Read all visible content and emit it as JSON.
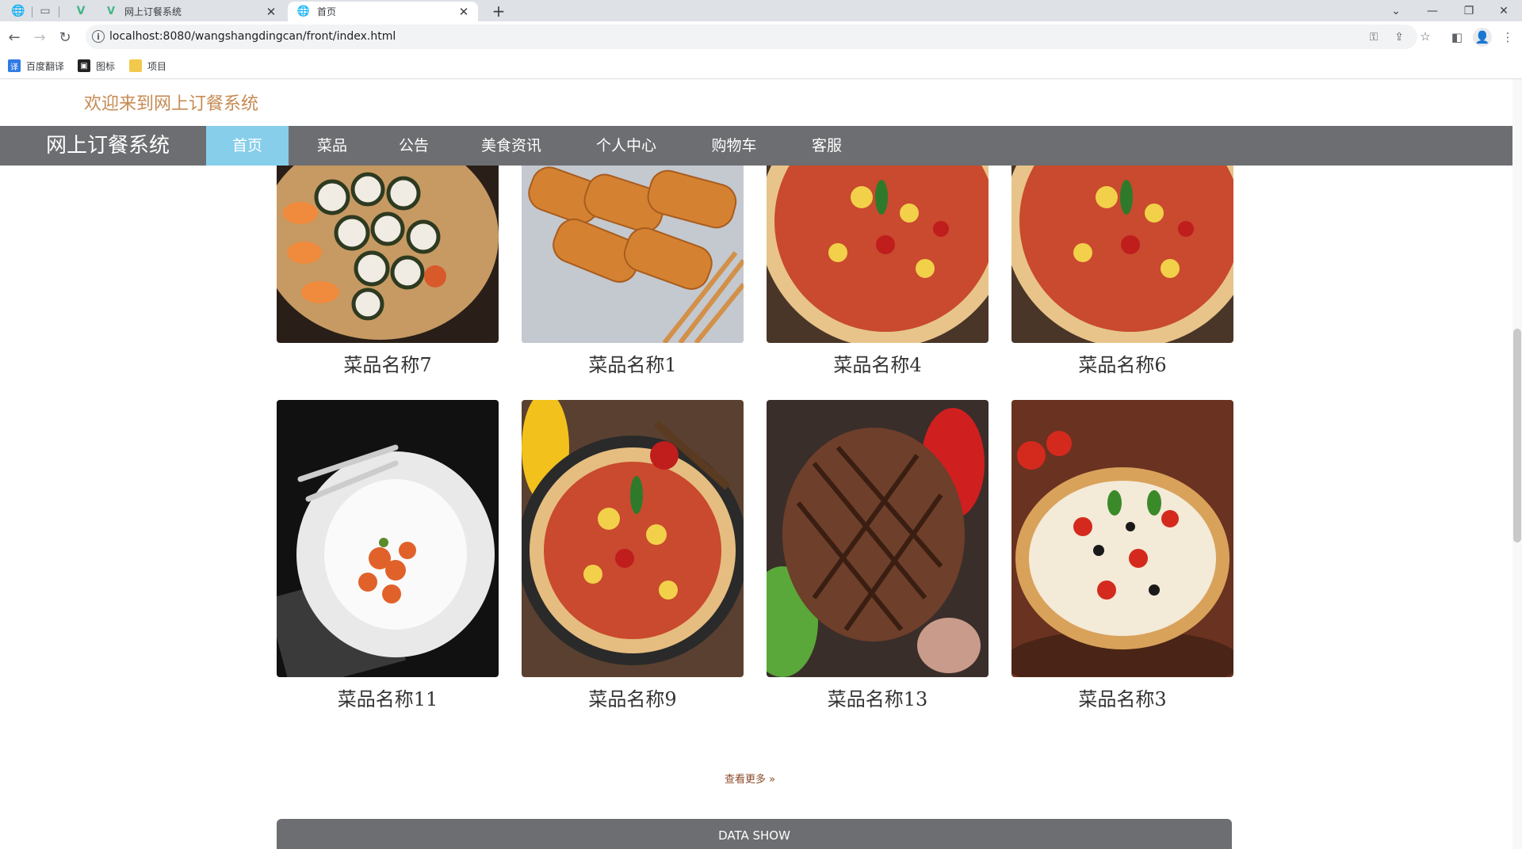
{
  "browser": {
    "tabs": [
      {
        "title": "网上订餐系统",
        "active": false
      },
      {
        "title": "首页",
        "active": true
      }
    ],
    "url": "localhost:8080/wangshangdingcan/front/index.html",
    "bookmarks": [
      "百度翻译",
      "图标",
      "项目"
    ]
  },
  "header": {
    "welcome": "欢迎来到网上订餐系统",
    "brand": "网上订餐系统",
    "nav": [
      "首页",
      "菜品",
      "公告",
      "美食资讯",
      "个人中心",
      "购物车",
      "客服"
    ],
    "active_nav": "首页"
  },
  "dishes_row1": [
    {
      "name": "菜品名称7",
      "image": "sushi-icon"
    },
    {
      "name": "菜品名称1",
      "image": "pastry-icon"
    },
    {
      "name": "菜品名称4",
      "image": "pizza-icon"
    },
    {
      "name": "菜品名称6",
      "image": "pizza-icon"
    }
  ],
  "dishes_row2": [
    {
      "name": "菜品名称11",
      "image": "plated-dish-icon"
    },
    {
      "name": "菜品名称9",
      "image": "pizza-icon"
    },
    {
      "name": "菜品名称13",
      "image": "steak-icon"
    },
    {
      "name": "菜品名称3",
      "image": "pizza-icon"
    }
  ],
  "more_label": "查看更多 »",
  "section_title": "DATA SHOW",
  "colors": {
    "welcome": "#c68a52",
    "nav_bg": "#6c6e71",
    "nav_active": "#87ceeb"
  }
}
